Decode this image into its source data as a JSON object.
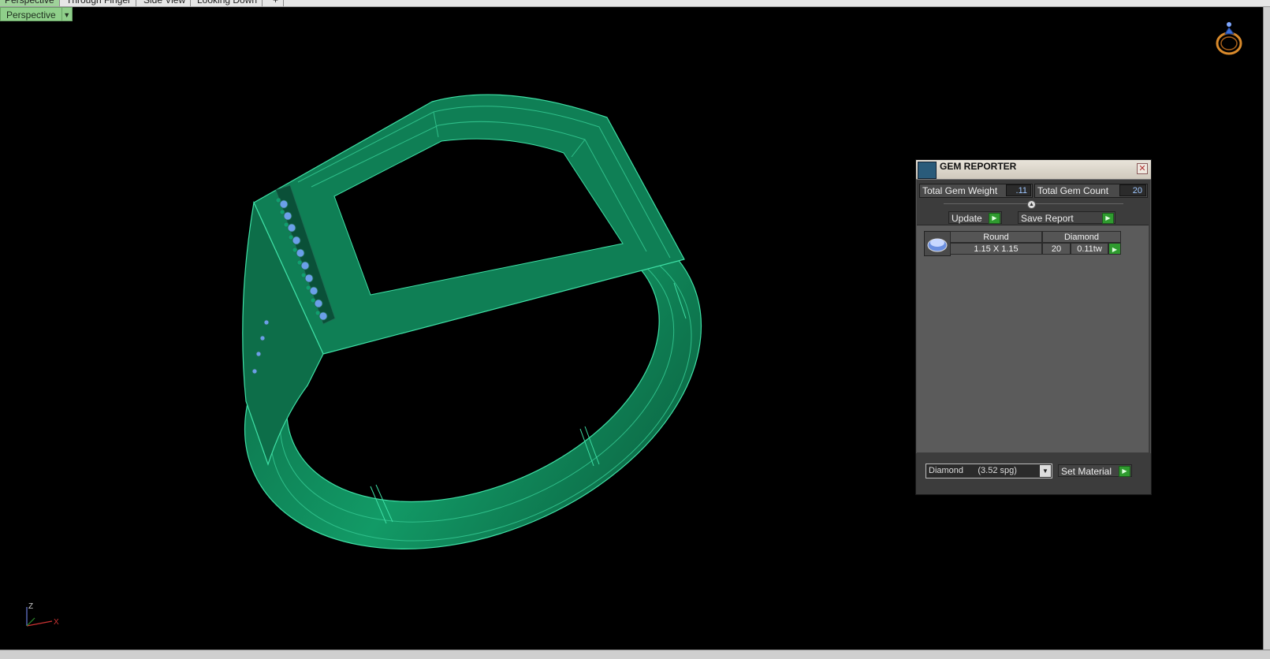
{
  "view_tabs": [
    "Perspective",
    "Through Finger",
    "Side View",
    "Looking Down",
    "+"
  ],
  "viewport": {
    "label": "Perspective",
    "dropdown_symbol": "▼"
  },
  "axis": {
    "z": "Z",
    "x": "X"
  },
  "gem_reporter": {
    "title": "GEM REPORTER",
    "close_symbol": "✕",
    "total_weight_label": "Total Gem Weight",
    "total_weight_value": ".11",
    "total_count_label": "Total Gem Count",
    "total_count_value": "20",
    "update_label": "Update",
    "save_report_label": "Save Report",
    "arrow_symbol": "▶",
    "gem_row": {
      "shape": "Round",
      "material": "Diamond",
      "size": "1.15 X 1.15",
      "count": "20",
      "weight": "0.11tw"
    },
    "material_select": "Diamond      (3.52 spg)",
    "select_arrow": "▼",
    "set_material_label": "Set Material"
  },
  "colors": {
    "ring_fill": "#0f8a5c",
    "ring_edge": "#35d49a",
    "gem_blue": "#6b9fe8",
    "accent_green": "#2f9b2f"
  }
}
